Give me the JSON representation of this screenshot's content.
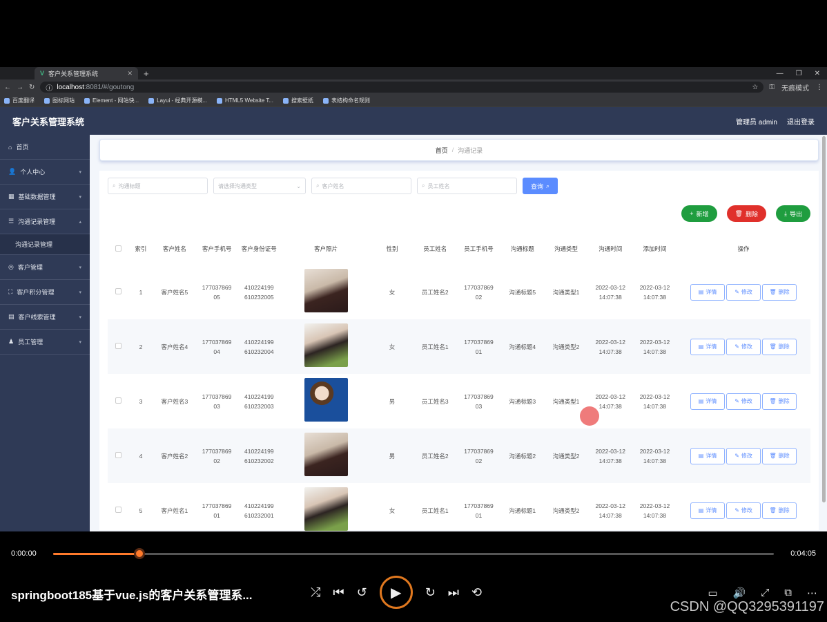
{
  "browser": {
    "tab_title": "客户关系管理系统",
    "url_host": "localhost",
    "url_rest": ":8081/#/goutong",
    "profile": "无痕模式",
    "bookmarks": [
      "百度翻译",
      "图标网站",
      "Element - 网站快...",
      "Layui - 经典开源模...",
      "HTML5 Website T...",
      "搜索壁纸",
      "表结构命名规则"
    ]
  },
  "app": {
    "title": "客户关系管理系统",
    "user": "管理员 admin",
    "logout": "退出登录"
  },
  "sidebar": {
    "items": [
      {
        "label": "首页",
        "chev": false
      },
      {
        "label": "个人中心",
        "chev": true
      },
      {
        "label": "基础数据管理",
        "chev": true
      },
      {
        "label": "沟通记录管理",
        "chev": true,
        "expanded": true
      }
    ],
    "sub_item": "沟通记录管理",
    "items2": [
      {
        "label": "客户管理"
      },
      {
        "label": "客户积分管理"
      },
      {
        "label": "客户线索管理"
      },
      {
        "label": "员工管理"
      }
    ]
  },
  "breadcrumb": {
    "home": "首页",
    "sep": "/",
    "current": "沟通记录"
  },
  "search": {
    "title_placeholder": "沟通标题",
    "type_placeholder": "请选择沟通类型",
    "customer_placeholder": "客户姓名",
    "staff_placeholder": "员工姓名",
    "query_label": "查询"
  },
  "actions": {
    "add": "新增",
    "delete": "删除",
    "export": "导出"
  },
  "table": {
    "headers": [
      "索引",
      "客户姓名",
      "客户手机号",
      "客户身份证号",
      "客户照片",
      "性别",
      "员工姓名",
      "员工手机号",
      "沟通标题",
      "沟通类型",
      "沟通时间",
      "添加时间",
      "操作"
    ],
    "op_labels": {
      "detail": "详情",
      "edit": "修改",
      "delete": "删除"
    },
    "rows": [
      {
        "index": "1",
        "name": "客户姓名5",
        "phone": "17703786905",
        "idcard": "410224199610232005",
        "photo": "male",
        "gender": "女",
        "staff": "员工姓名2",
        "staff_phone": "17703786902",
        "title": "沟通标题5",
        "type": "沟通类型1",
        "comm_time": "2022-03-12 14:07:38",
        "add_time": "2022-03-12 14:07:38"
      },
      {
        "index": "2",
        "name": "客户姓名4",
        "phone": "17703786904",
        "idcard": "410224199610232004",
        "photo": "female",
        "gender": "女",
        "staff": "员工姓名1",
        "staff_phone": "17703786901",
        "title": "沟通标题4",
        "type": "沟通类型2",
        "comm_time": "2022-03-12 14:07:38",
        "add_time": "2022-03-12 14:07:38"
      },
      {
        "index": "3",
        "name": "客户姓名3",
        "phone": "17703786903",
        "idcard": "410224199610232003",
        "photo": "blue",
        "gender": "男",
        "staff": "员工姓名3",
        "staff_phone": "17703786903",
        "title": "沟通标题3",
        "type": "沟通类型1",
        "comm_time": "2022-03-12 14:07:38",
        "add_time": "2022-03-12 14:07:38"
      },
      {
        "index": "4",
        "name": "客户姓名2",
        "phone": "17703786902",
        "idcard": "410224199610232002",
        "photo": "male",
        "gender": "男",
        "staff": "员工姓名2",
        "staff_phone": "17703786902",
        "title": "沟通标题2",
        "type": "沟通类型2",
        "comm_time": "2022-03-12 14:07:38",
        "add_time": "2022-03-12 14:07:38"
      },
      {
        "index": "5",
        "name": "客户姓名1",
        "phone": "17703786901",
        "idcard": "410224199610232001",
        "photo": "female",
        "gender": "女",
        "staff": "员工姓名1",
        "staff_phone": "17703786901",
        "title": "沟通标题1",
        "type": "沟通类型2",
        "comm_time": "2022-03-12 14:07:38",
        "add_time": "2022-03-12 14:07:38"
      }
    ]
  },
  "player": {
    "current_time": "0:00:00",
    "duration": "0:04:05",
    "progress": 0.12,
    "title": "springboot185基于vue.js的客户关系管理系...",
    "watermark": "CSDN @QQ3295391197"
  },
  "colors": {
    "sidebar_bg": "#2f3a56",
    "primary": "#5b8cff",
    "green": "#1f9d3f",
    "red": "#e0302b",
    "player_accent": "#ff7a2b"
  }
}
